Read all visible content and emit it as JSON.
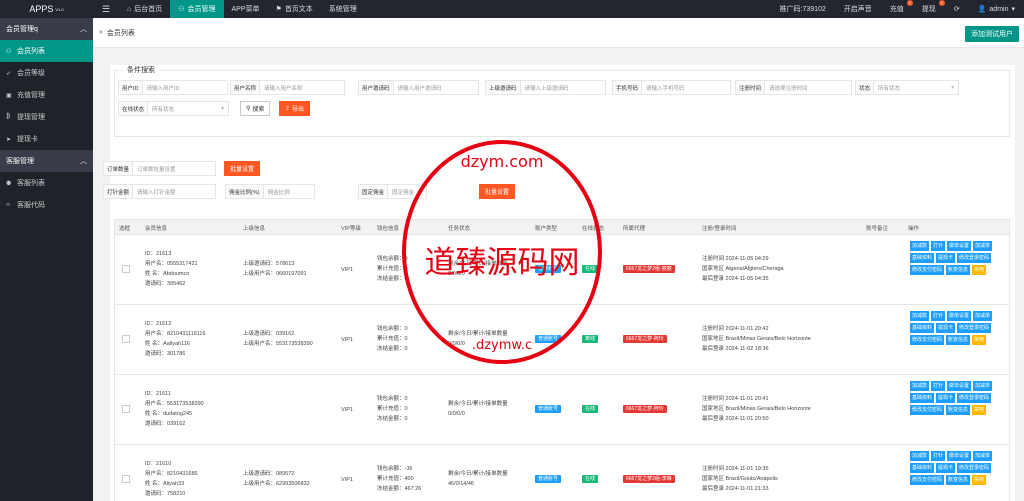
{
  "topbar": {
    "logo": "APPS",
    "logo_version": "V1.0",
    "nav": [
      {
        "label": "后台首页",
        "icon": "home-icon",
        "active": false
      },
      {
        "label": "会员管理",
        "icon": "user-icon",
        "active": true
      },
      {
        "label": "APP菜单",
        "icon": "",
        "active": false
      },
      {
        "label": "首页文本",
        "icon": "flag-icon",
        "active": false
      },
      {
        "label": "系统管理",
        "icon": "",
        "active": false
      }
    ],
    "right": {
      "promo_code": "推广码:739102",
      "sound": "开启声音",
      "recharge": "充值",
      "recharge_badge": "0",
      "withdraw": "提现",
      "withdraw_badge": "0",
      "user": "admin"
    }
  },
  "sidebar": {
    "groups": [
      {
        "label": "会员管理q",
        "items": [
          {
            "label": "会员列表",
            "icon": "user-icon",
            "active": true
          },
          {
            "label": "会员等级",
            "icon": "rocket-icon",
            "active": false
          },
          {
            "label": "充值管理",
            "icon": "money-icon",
            "active": false
          },
          {
            "label": "提现管理",
            "icon": "bitcoin-icon",
            "active": false
          },
          {
            "label": "提现卡",
            "icon": "send-icon",
            "active": false
          }
        ]
      },
      {
        "label": "客服管理",
        "items": [
          {
            "label": "客服列表",
            "icon": "users-icon",
            "active": false
          },
          {
            "label": "客服代码",
            "icon": "code-icon",
            "active": false
          }
        ]
      }
    ]
  },
  "main": {
    "tab": "会员列表",
    "add_button": "添加测试用户",
    "filter": {
      "legend": "条件搜索",
      "user_id": {
        "label": "用户ID",
        "placeholder": "请输入用户ID"
      },
      "user_name": {
        "label": "用户名称",
        "placeholder": "请输入用户名称"
      },
      "invite_code": {
        "label": "用户邀请码",
        "placeholder": "请输入用户邀请码"
      },
      "parent_code": {
        "label": "上级邀请码",
        "placeholder": "请输入上级邀请码"
      },
      "phone": {
        "label": "手机号码",
        "placeholder": "请输入手机号码"
      },
      "reg_time": {
        "label": "注册时间",
        "placeholder": "请选择注册时间"
      },
      "status": {
        "label": "状态",
        "value": "所有状态"
      },
      "online": {
        "label": "在线状态",
        "value": "所有状态"
      },
      "search_btn": "搜索",
      "export_btn": "导出"
    },
    "batch": {
      "order_label": "订单数量",
      "order_placeholder": "订单数批量设置",
      "order_btn": "批量设置",
      "freeze_label": "打针金额",
      "freeze_placeholder": "请输入打针金额",
      "commission_label": "佣金比例(%)",
      "commission_placeholder": "佣金比例",
      "fixed_label": "固定佣金",
      "fixed_placeholder": "固定佣金",
      "batch_btn": "批量设置"
    },
    "table": {
      "headers": [
        "选框",
        "会员信息",
        "上级信息",
        "VIP等级",
        "钱包信息",
        "任务状态",
        "账户类型",
        "在线状态",
        "所属代理",
        "注册/登录时间",
        "账号备注",
        "操作"
      ],
      "rows": [
        {
          "id": "ID：21613",
          "username": "用户名：0555317421",
          "name": "姓 名：Abdoumco",
          "invite": "邀请码：395462",
          "parent_code": "上级邀请码：578613",
          "parent_user": "上级用户名：0660197091",
          "vip": "VIP1",
          "wallet_balance": "钱包余额：0",
          "wallet_recharge": "累计充值：0",
          "wallet_frozen": "冻结金额：0",
          "task_label": "剩余/今日/累计/接单数量",
          "task_value": "0/0/0/0",
          "account_type": "普通账号",
          "online": "在线",
          "agent": "6667龙之梦2组-丽丽",
          "reg_time": "注册时间 2024-11-05 04:29",
          "region": "国家地区 Algeria/Algiers/Cheraga",
          "last_login": "最后登录 2024-11-05 04:35"
        },
        {
          "id": "ID：21612",
          "username": "用户名：8210431116116",
          "name": "姓 名：Aaliyah116",
          "invite": "邀请码：301786",
          "parent_code": "上级邀请码：039162",
          "parent_user": "上级用户名：553173538390",
          "vip": "VIP1",
          "wallet_balance": "钱包余额：0",
          "wallet_recharge": "累计充值：0",
          "wallet_frozen": "冻结金额：0",
          "task_label": "剩余/今日/累计/接单数量",
          "task_value": "0/0/0/0",
          "account_type": "普通账号",
          "online": "离线",
          "agent": "6667龙之梦-阿玲",
          "reg_time": "注册时间 2024-11-01 20:42",
          "region": "国家地区 Brazil/Minas Gerais/Belo Horizonte",
          "last_login": "最后登录 2024-11-02 18:36"
        },
        {
          "id": "ID：21611",
          "username": "用户名：553173538390",
          "name": "姓 名：dudatog245",
          "invite": "邀请码：039162",
          "parent_code": "",
          "parent_user": "",
          "vip": "VIP1",
          "wallet_balance": "钱包余额：0",
          "wallet_recharge": "累计充值：0",
          "wallet_frozen": "冻结金额：0",
          "task_label": "剩余/今日/累计/接单数量",
          "task_value": "0/0/0/0",
          "account_type": "普通账号",
          "online": "在线",
          "agent": "6667龙之梦-阿玲",
          "reg_time": "注册时间 2024-11-01 20:41",
          "region": "国家地区 Brazil/Minas Gerais/Belo Horizonte",
          "last_login": "最后登录 2024-11-01 20:50"
        },
        {
          "id": "ID：21610",
          "username": "用户名：8210431686",
          "name": "姓 名：Aliyah33",
          "invite": "邀请码：758210",
          "parent_code": "上级邀请码：089572",
          "parent_user": "上级用户名：62993506832",
          "vip": "VIP1",
          "wallet_balance": "钱包余额：-36",
          "wallet_recharge": "累计充值：400",
          "wallet_frozen": "冻结金额：467.26",
          "task_label": "剩余/今日/累计/接单数量",
          "task_value": "46/0/14/46",
          "account_type": "普通账号",
          "online": "在线",
          "agent": "6667龙之梦2组-李琳",
          "reg_time": "注册时间 2024-11-01 19:35",
          "region": "国家地区 Brazil/Goiás/Anápolis",
          "last_login": "最后登录 2024-11-01 21:33"
        }
      ],
      "ops": [
        {
          "label": "加减款",
          "color": "blue"
        },
        {
          "label": "打针",
          "color": "blue"
        },
        {
          "label": "做单设置",
          "color": "blue"
        },
        {
          "label": "加减单",
          "color": "blue"
        },
        {
          "label": "基础资料",
          "color": "blue"
        },
        {
          "label": "提现卡",
          "color": "blue"
        },
        {
          "label": "修改登录密码",
          "color": "blue"
        },
        {
          "label": "修改支付密码",
          "color": "blue"
        },
        {
          "label": "账变信息",
          "color": "blue"
        },
        {
          "label": "禁用",
          "color": "yellow"
        }
      ]
    }
  },
  "watermark": {
    "text": "道臻源码网",
    "ring_top": "dzym.com",
    "ring_bottom": ".dzymw.c",
    "color": "#e60012"
  }
}
